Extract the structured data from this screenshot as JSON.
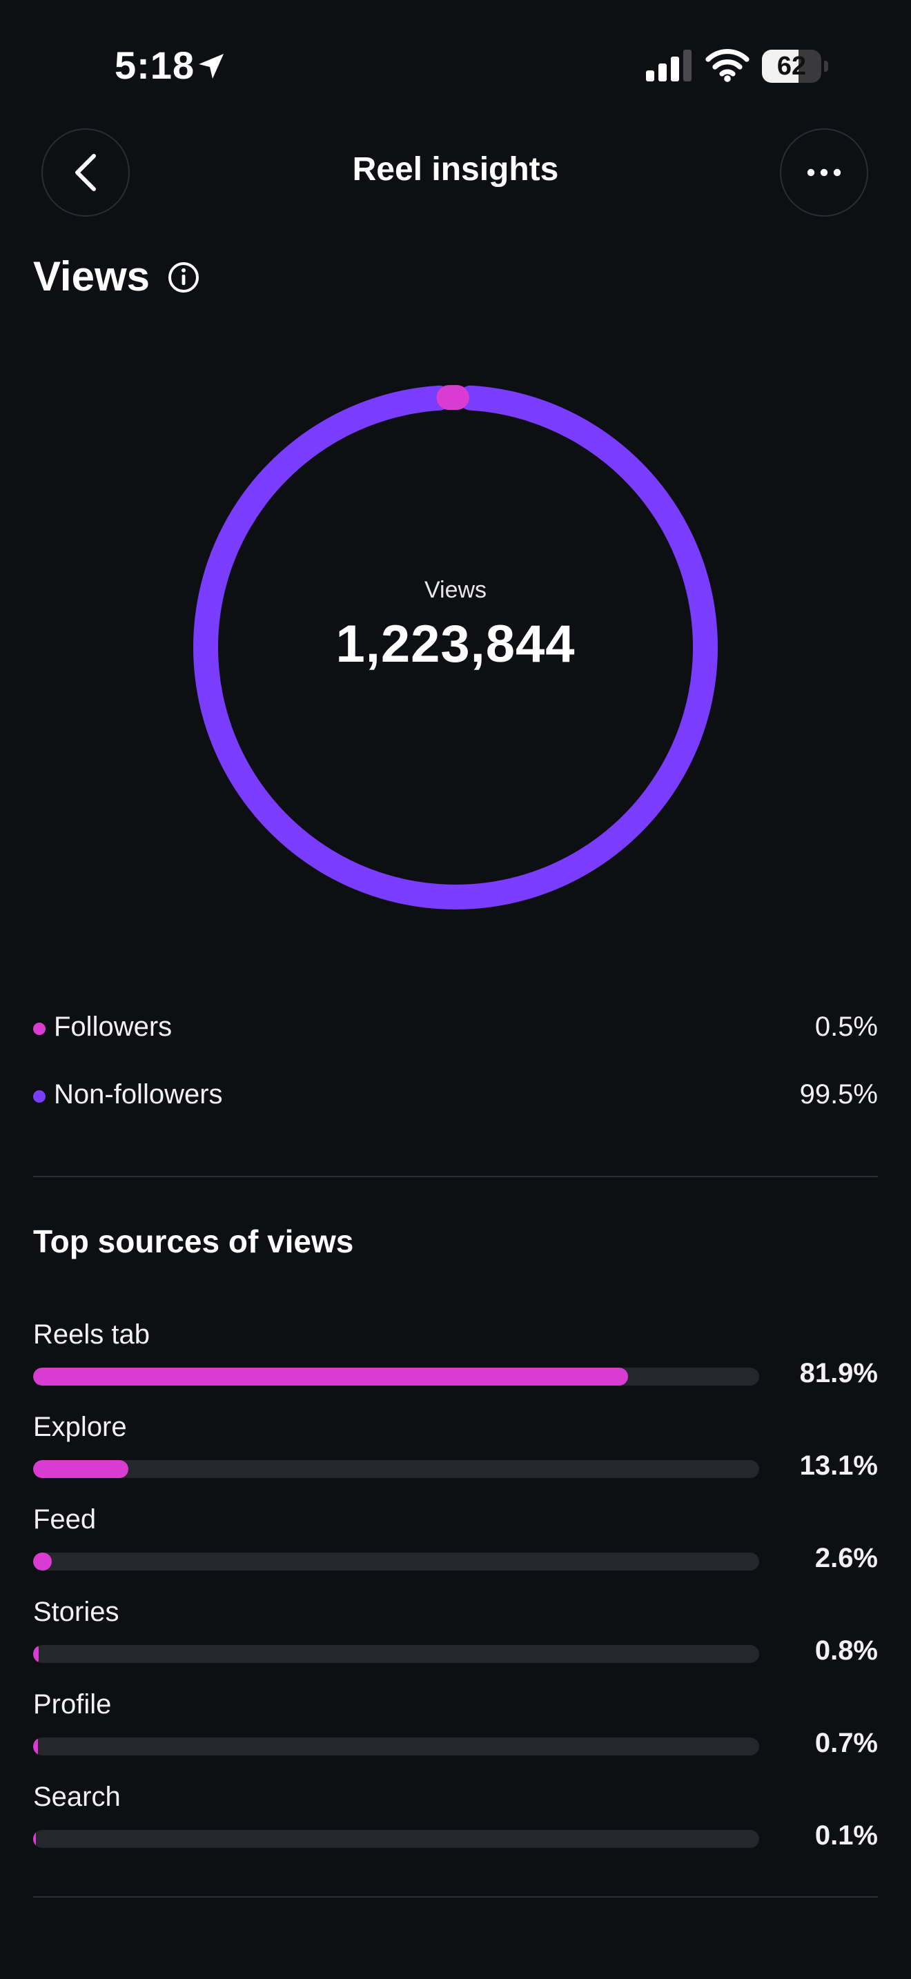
{
  "status_bar": {
    "time": "5:18",
    "battery": "62",
    "battery_level": 0.62
  },
  "header": {
    "title": "Reel insights"
  },
  "views": {
    "title": "Views",
    "donut_label": "Views",
    "total": "1,223,844"
  },
  "colors": {
    "followers": "#d83cd1",
    "non_followers": "#7a3cff",
    "background": "#0d0f13"
  },
  "audience": [
    {
      "label": "Followers",
      "value": "0.5%",
      "fraction": 0.005,
      "color": "#d83cd1"
    },
    {
      "label": "Non-followers",
      "value": "99.5%",
      "fraction": 0.995,
      "color": "#7a3cff"
    }
  ],
  "sources": {
    "title": "Top sources of views",
    "items": [
      {
        "label": "Reels tab",
        "value": "81.9%",
        "fraction": 0.819
      },
      {
        "label": "Explore",
        "value": "13.1%",
        "fraction": 0.131
      },
      {
        "label": "Feed",
        "value": "2.6%",
        "fraction": 0.026
      },
      {
        "label": "Stories",
        "value": "0.8%",
        "fraction": 0.008
      },
      {
        "label": "Profile",
        "value": "0.7%",
        "fraction": 0.007
      },
      {
        "label": "Search",
        "value": "0.1%",
        "fraction": 0.001
      }
    ]
  },
  "icons": {
    "back": "chevron-left-icon",
    "more": "ellipsis-icon",
    "info": "info-icon",
    "location": "location-arrow-icon"
  }
}
